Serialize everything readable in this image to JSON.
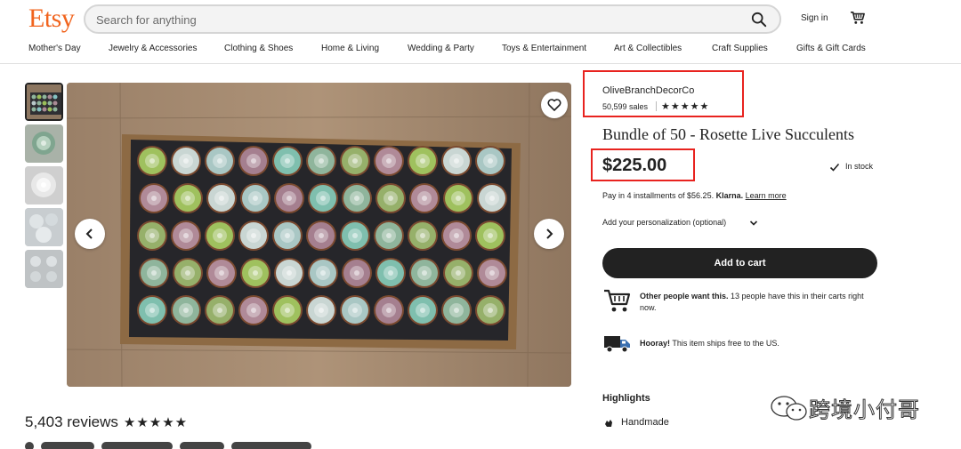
{
  "header": {
    "logo": "Etsy",
    "search_placeholder": "Search for anything",
    "signin_label": "Sign in"
  },
  "nav": {
    "items": [
      "Mother's Day",
      "Jewelry & Accessories",
      "Clothing & Shoes",
      "Home & Living",
      "Wedding & Party",
      "Toys & Entertainment",
      "Art & Collectibles",
      "Craft Supplies",
      "Gifts & Gift Cards"
    ]
  },
  "gallery": {
    "thumbnail_count": 5,
    "selected_index": 0
  },
  "reviews": {
    "count_label": "5,403 reviews",
    "rating_stars": 5,
    "stars_glyph": "★★★★★"
  },
  "listing": {
    "shop_name": "OliveBranchDecorCo",
    "sales": "50,599 sales",
    "shop_stars_glyph": "★★★★★",
    "title": "Bundle of 50 - Rosette Live Succulents",
    "price": "$225.00",
    "stock_status": "In stock",
    "installments_text": "Pay in 4 installments of $56.25.",
    "klarna_label": "Klarna.",
    "learn_more": "Learn more",
    "personalization_label": "Add your personalization (optional)",
    "add_to_cart": "Add to cart",
    "cart_note_bold": "Other people want this.",
    "cart_note_rest": " 13 people have this in their carts right now.",
    "shipping_bold": "Hooray!",
    "shipping_rest": " This item ships free to the US.",
    "highlights_title": "Highlights",
    "highlight_item": "Handmade"
  },
  "watermark": {
    "text": "跨境小付哥"
  },
  "colors": {
    "brand": "#f1641e",
    "annotation_red": "#e8231f",
    "button_dark": "#222222"
  }
}
